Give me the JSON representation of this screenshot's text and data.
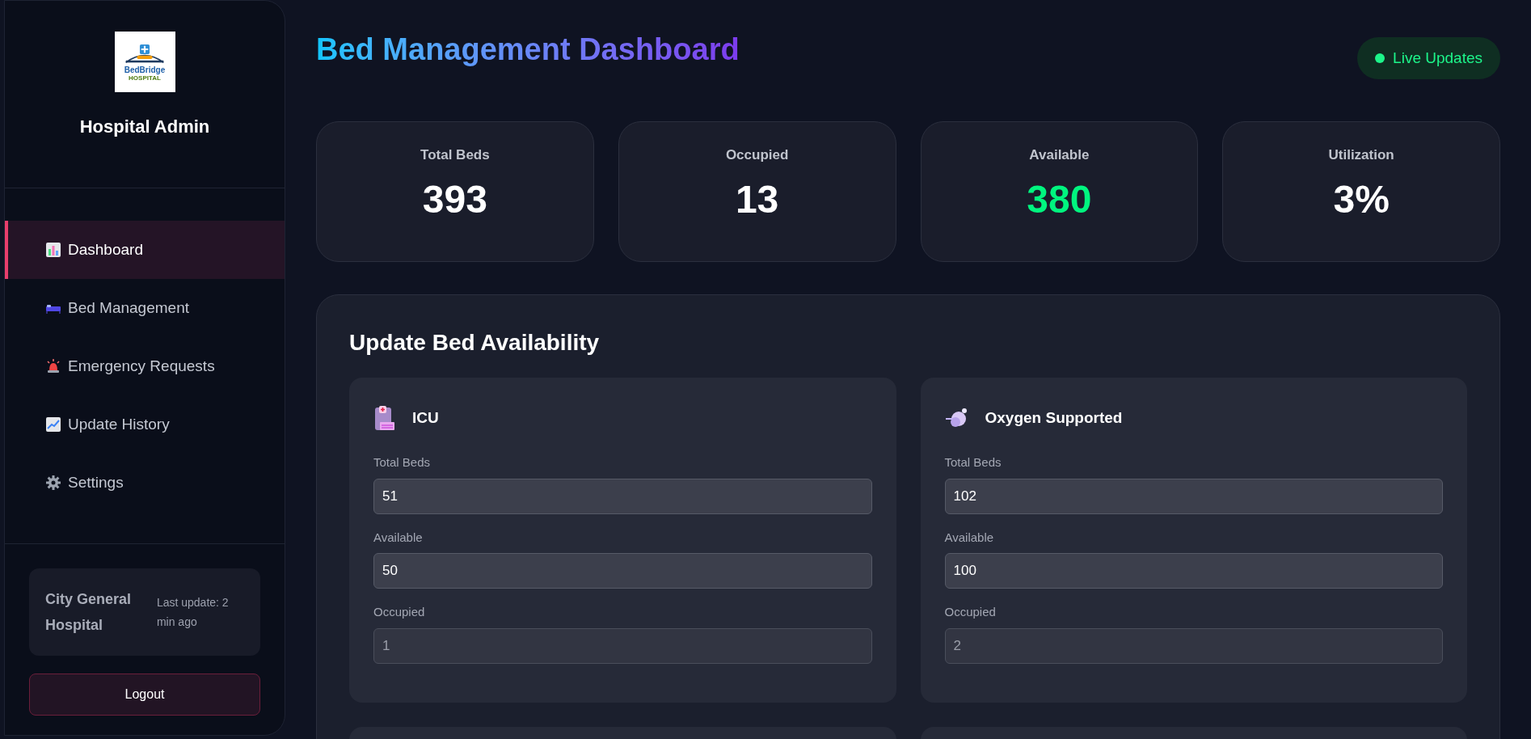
{
  "sidebar": {
    "logo": {
      "name": "BedBridge",
      "subtitle": "HOSPITAL"
    },
    "title": "Hospital Admin",
    "items": [
      {
        "label": "Dashboard",
        "kind": "chart",
        "selected": true
      },
      {
        "label": "Bed Management",
        "kind": "bed",
        "selected": false
      },
      {
        "label": "Emergency Requests",
        "kind": "siren",
        "selected": false
      },
      {
        "label": "Update History",
        "kind": "trend",
        "selected": false
      },
      {
        "label": "Settings",
        "kind": "gear",
        "selected": false
      }
    ],
    "hospital": {
      "name": "City General Hospital",
      "update": "Last update: 2 min ago"
    },
    "logout": "Logout"
  },
  "header": {
    "title": "Bed Management Dashboard",
    "badge": "Live Updates"
  },
  "stats": [
    {
      "label": "Total Beds",
      "value": "393",
      "color": "#ffffff"
    },
    {
      "label": "Occupied",
      "value": "13",
      "color": "#ffffff"
    },
    {
      "label": "Available",
      "value": "380",
      "color": "#00f57f"
    },
    {
      "label": "Utilization",
      "value": "3%",
      "color": "#ffffff"
    }
  ],
  "panel": {
    "title": "Update Bed Availability",
    "bed_types": [
      {
        "name": "ICU",
        "kind": "icu",
        "fields": [
          {
            "label": "Total Beds",
            "value": "51",
            "disabled": false
          },
          {
            "label": "Available",
            "value": "50",
            "disabled": false
          },
          {
            "label": "Occupied",
            "value": "1",
            "disabled": true
          }
        ]
      },
      {
        "name": "Oxygen Supported",
        "kind": "oxygen",
        "fields": [
          {
            "label": "Total Beds",
            "value": "102",
            "disabled": false
          },
          {
            "label": "Available",
            "value": "100",
            "disabled": false
          },
          {
            "label": "Occupied",
            "value": "2",
            "disabled": true
          }
        ]
      }
    ]
  }
}
